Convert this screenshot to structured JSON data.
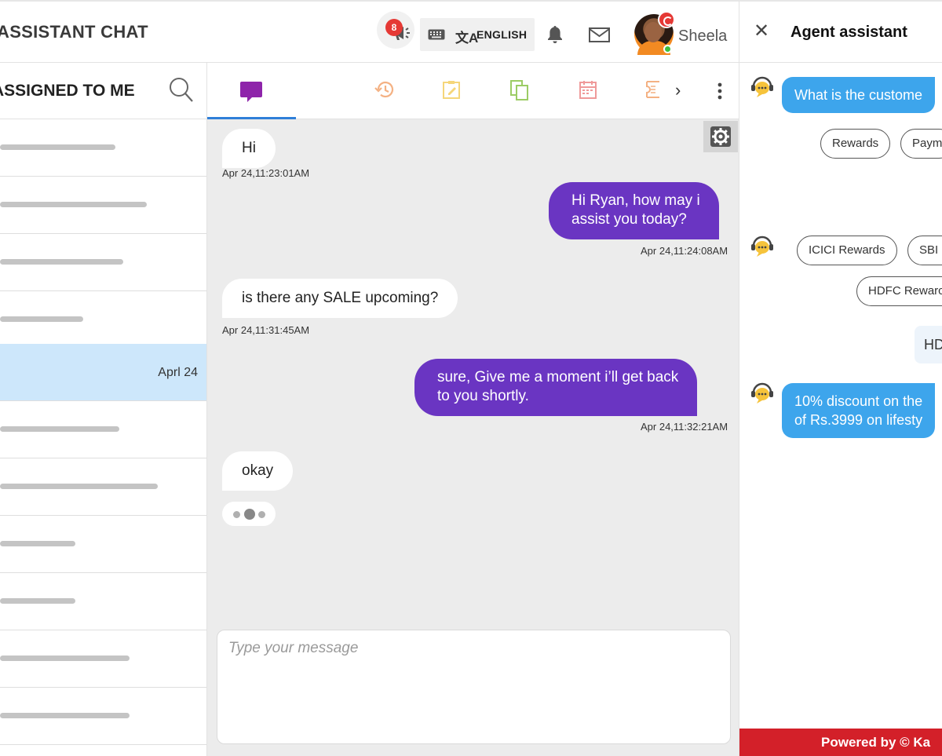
{
  "header": {
    "app_title": "ASSISTANT CHAT",
    "announce_count": "8",
    "language_label": "ENGLISH",
    "user_name": "Sheela"
  },
  "left_panel": {
    "title": "ASSIGNED TO ME",
    "active_date": "Aprl 24"
  },
  "chat": {
    "messages": [
      {
        "direction": "in",
        "text": "Hi",
        "time": "Apr 24,11:23:01AM"
      },
      {
        "direction": "out",
        "line1": "Hi Ryan, how may i",
        "line2": "assist you today?",
        "time": "Apr 24,11:24:08AM"
      },
      {
        "direction": "in",
        "text": "is there any SALE upcoming?",
        "time": "Apr 24,11:31:45AM"
      },
      {
        "direction": "out",
        "line1": "sure, Give me a moment i’ll get back",
        "line2": "to you shortly.",
        "time": "Apr 24,11:32:21AM"
      },
      {
        "direction": "in",
        "text": "okay"
      }
    ],
    "composer_placeholder": "Type your message"
  },
  "agent_assistant": {
    "title": "Agent assistant",
    "question": "What is the custome",
    "chips_1": [
      "Rewards",
      "Paym"
    ],
    "chips_2": [
      "ICICI Rewards",
      "SBI I",
      "HDFC Rewarc"
    ],
    "reply": "HD",
    "answer_line1": "10% discount on the",
    "answer_line2": "of Rs.3999 on lifesty",
    "footer": "Powered by © Ka"
  },
  "colors": {
    "outgoing_bubble": "#6a35c2",
    "assistant_bubble": "#3da5ec",
    "active_row": "#cde7fb",
    "footer_red": "#d32029",
    "badge_red": "#e53935",
    "active_tab_underline": "#2f7fd8"
  },
  "icons": [
    "megaphone-icon",
    "keyboard-icon",
    "translate-icon",
    "bell-icon",
    "mail-icon",
    "search-icon",
    "chat-icon",
    "history-icon",
    "notes-icon",
    "copy-icon",
    "calendar-icon",
    "ticket-icon",
    "chevron-right-icon",
    "kebab-menu-icon",
    "gear-icon",
    "close-icon",
    "bot-icon"
  ]
}
